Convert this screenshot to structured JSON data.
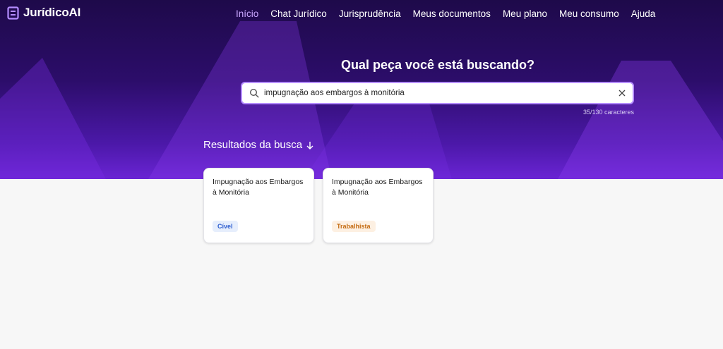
{
  "brand": {
    "name": "JurídicoAI"
  },
  "nav": {
    "items": [
      {
        "label": "Início",
        "active": true
      },
      {
        "label": "Chat Jurídico",
        "active": false
      },
      {
        "label": "Jurisprudência",
        "active": false
      },
      {
        "label": "Meus documentos",
        "active": false
      },
      {
        "label": "Meu plano",
        "active": false
      },
      {
        "label": "Meu consumo",
        "active": false
      },
      {
        "label": "Ajuda",
        "active": false
      }
    ]
  },
  "search": {
    "headline": "Qual peça você está buscando?",
    "value": "impugnação aos embargos à monitória",
    "char_count": "35/130 caracteres"
  },
  "results": {
    "title": "Resultados da busca",
    "cards": [
      {
        "title": "Impugnação aos Embargos à Monitória",
        "badge": "Cível",
        "badge_color": "#2f5fd0",
        "badge_bg": "#e6eefc"
      },
      {
        "title": "Impugnação aos Embargos à Monitória",
        "badge": "Trabalhista",
        "badge_color": "#c46a10",
        "badge_bg": "#fdf0e2"
      }
    ]
  },
  "colors": {
    "accent": "#c9a6ff",
    "hero_top": "#1e0a4a",
    "hero_bottom": "#6a24d4"
  }
}
